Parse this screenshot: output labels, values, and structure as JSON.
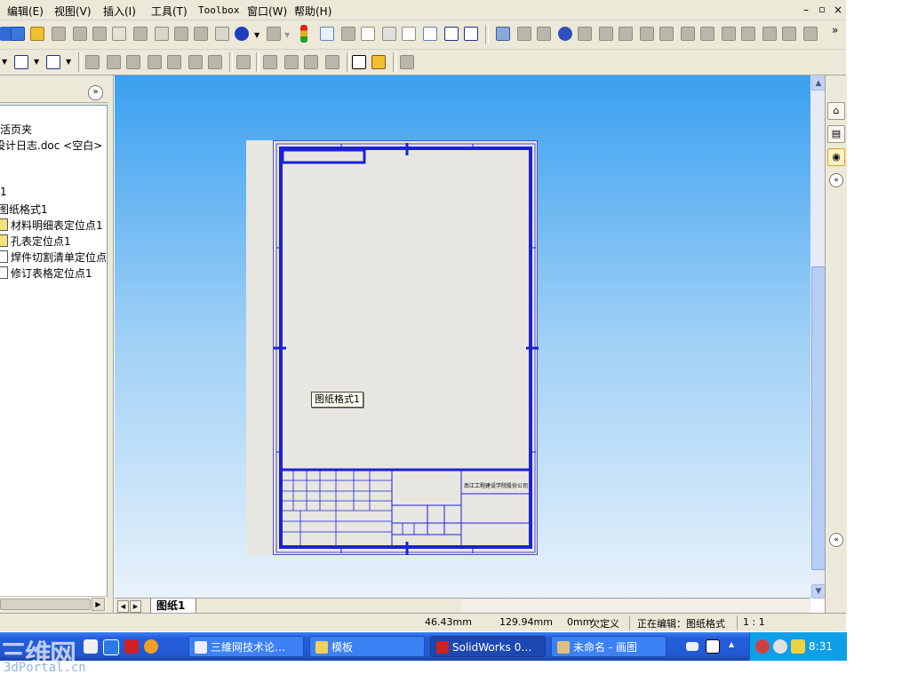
{
  "menu": {
    "items": [
      "编辑(E)",
      "视图(V)",
      "插入(I)",
      "工具(T)",
      "Toolbox",
      "窗口(W)",
      "帮助(H)"
    ],
    "window_controls": [
      "–",
      "▫",
      "×"
    ]
  },
  "left_panel": {
    "collapse_glyph": "»",
    "tree": [
      "活页夹",
      "设计日志.doc <空白>",
      "1",
      "图纸格式1",
      "材料明细表定位点1",
      "孔表定位点1",
      "焊件切割清单定位点",
      "修订表格定位点1"
    ]
  },
  "drawing": {
    "sheet_format_label": "图纸格式1",
    "company_text": "南江工程建设学院股份公司",
    "tab_label": "图纸1"
  },
  "status": {
    "x": "46.43mm",
    "y": "129.94mm",
    "z": "0mm",
    "definition": "欠定义",
    "editing": "正在编辑：图纸格式",
    "scale": "1 : 1"
  },
  "taskbar": {
    "buttons": [
      "三維网技术论…",
      "模板",
      "SolidWorks 0…",
      "未命名 - 画图"
    ],
    "clock": "8:31"
  },
  "watermark": {
    "small": "3dPortal.cn",
    "large": "三维网"
  },
  "colors": {
    "frame_blue": "#1a22d6",
    "graphics_top": "#3aa0f0",
    "taskbar_blue": "#245edc"
  }
}
